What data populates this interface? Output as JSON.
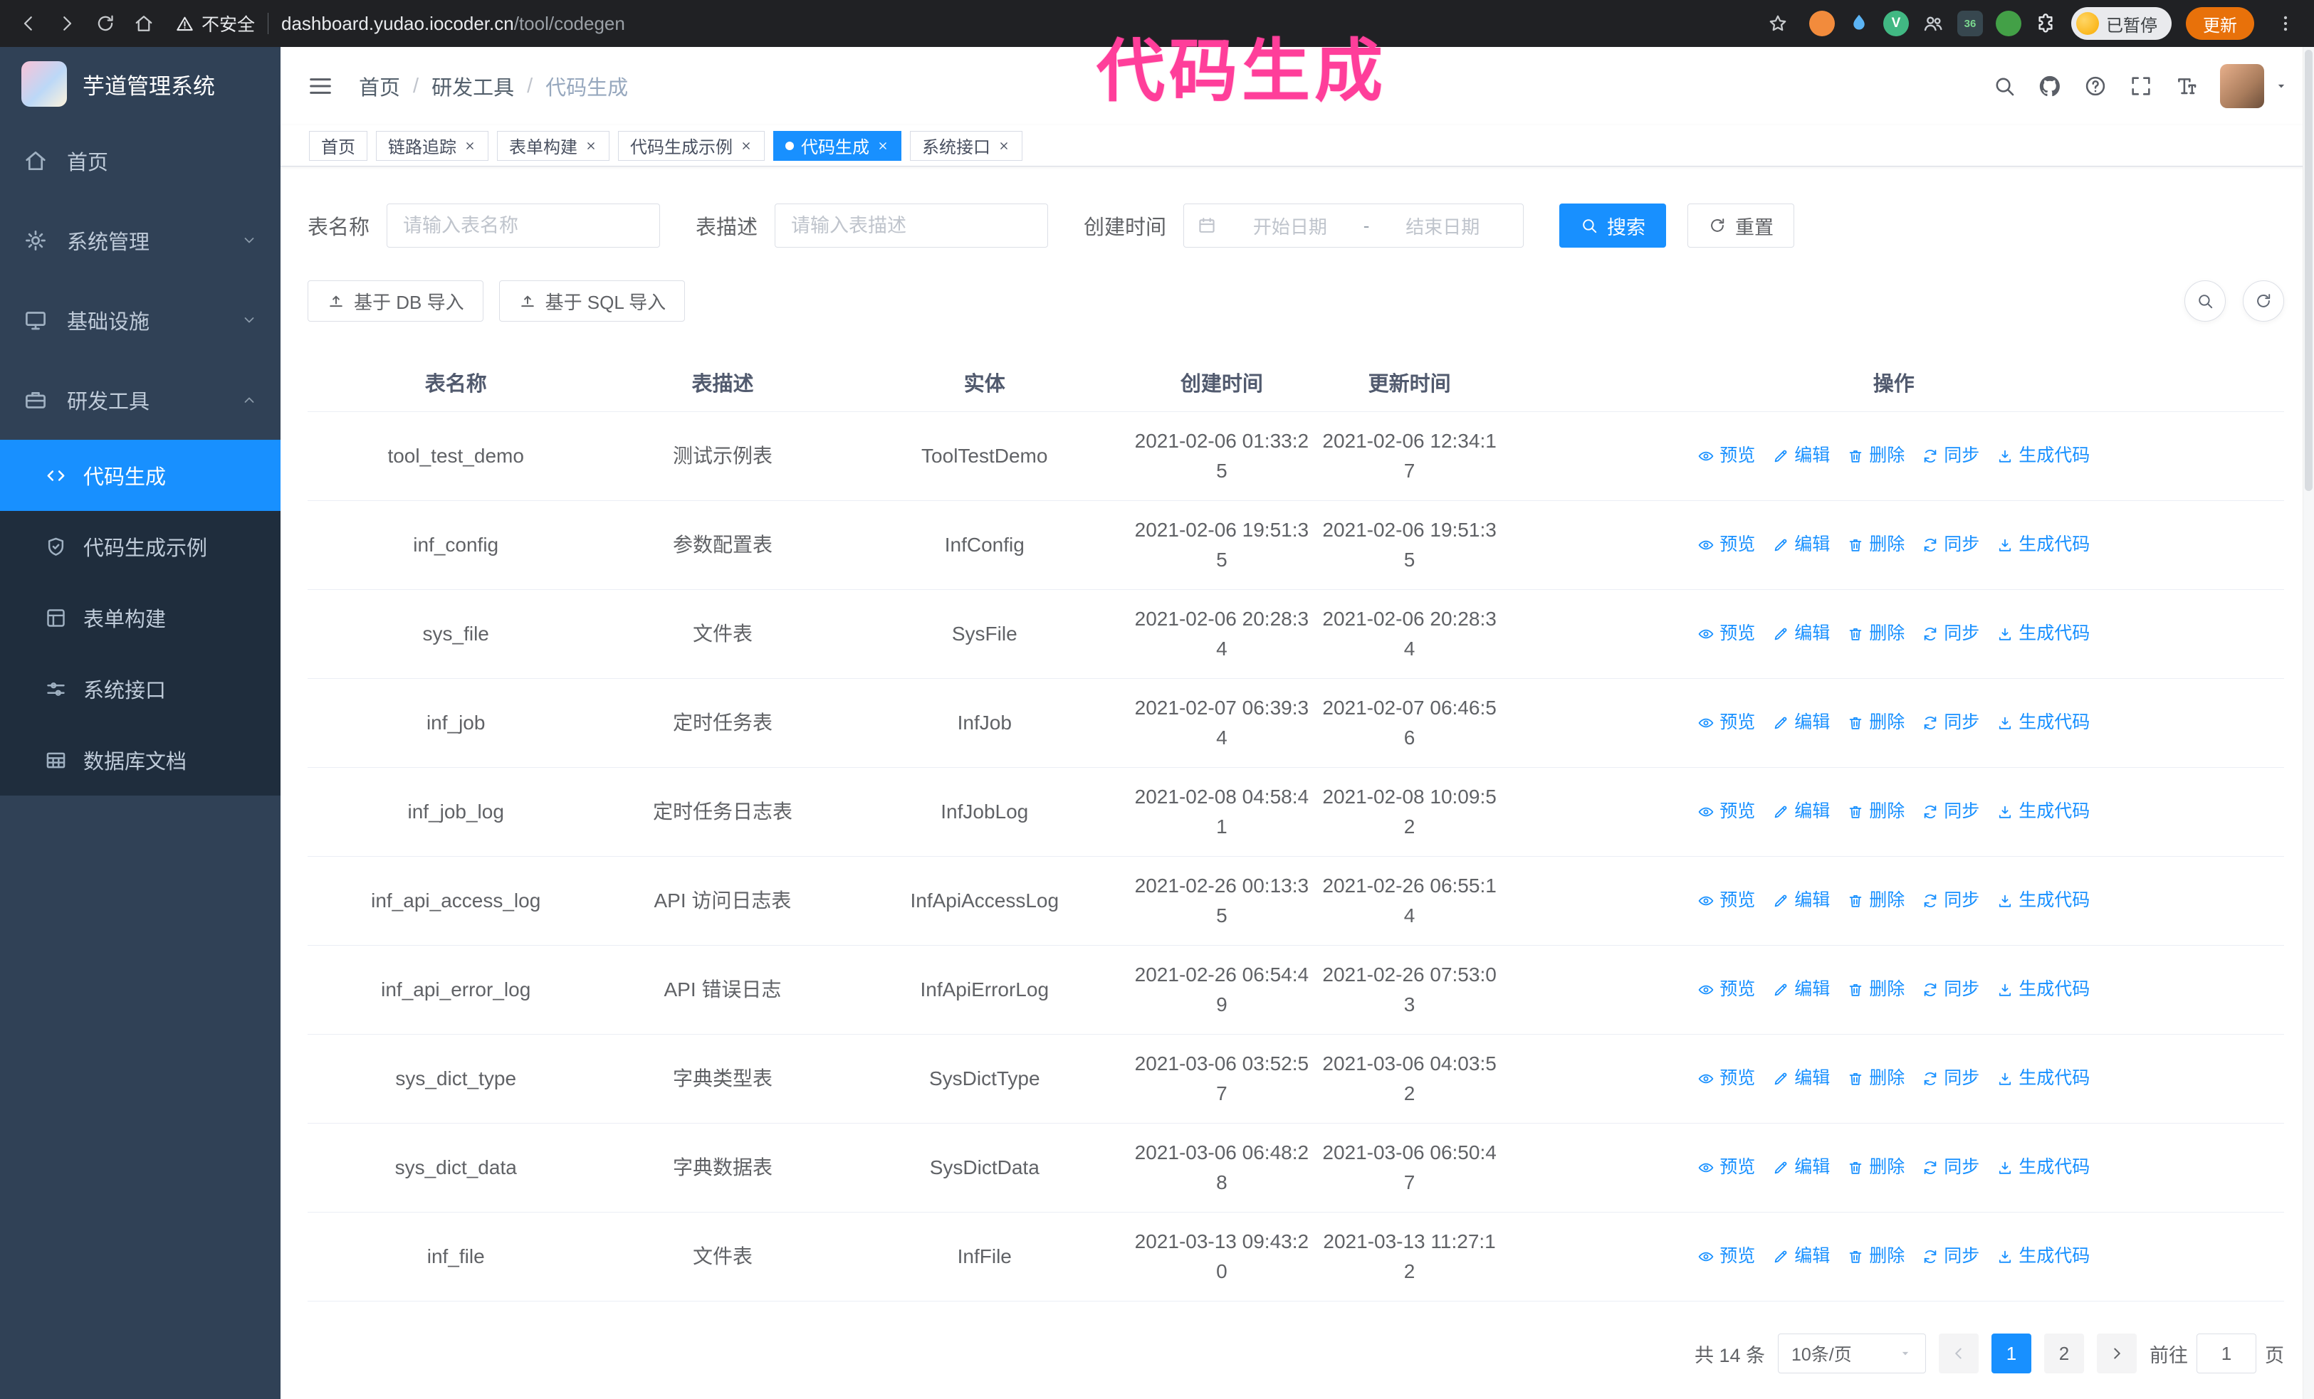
{
  "browser": {
    "security_label": "不安全",
    "url_host": "dashboard.yudao.iocoder.cn",
    "url_path": "/tool/codegen",
    "extensions": [
      {
        "id": "proxy",
        "shape": "circle",
        "color": "#f28b3c"
      },
      {
        "id": "drop",
        "shape": "icon",
        "icon": "drop",
        "color": "#5bb4f5"
      },
      {
        "id": "vue",
        "shape": "circle",
        "color": "#41b883",
        "label": "V"
      },
      {
        "id": "people",
        "shape": "icon",
        "icon": "people",
        "color": "#c9cdd2"
      },
      {
        "id": "badge",
        "shape": "square",
        "color": "#37474f",
        "label": "36",
        "label_color": "#7bd88f"
      },
      {
        "id": "leaf",
        "shape": "circle",
        "color": "#43a047"
      },
      {
        "id": "puzzle",
        "shape": "icon",
        "icon": "puzzle",
        "color": "#e8eaed"
      }
    ],
    "profile_badge": "已暂停",
    "update_label": "更新"
  },
  "annotation": {
    "text": "代码生成",
    "color": "#ff3e9a"
  },
  "sidebar": {
    "logo_title": "芋道管理系统",
    "menu": [
      {
        "id": "home",
        "label": "首页",
        "icon": "home",
        "type": "item"
      },
      {
        "id": "system",
        "label": "系统管理",
        "icon": "gear",
        "type": "group",
        "state": "collapsed"
      },
      {
        "id": "infra",
        "label": "基础设施",
        "icon": "monitor",
        "type": "group",
        "state": "collapsed"
      },
      {
        "id": "devtools",
        "label": "研发工具",
        "icon": "toolbox",
        "type": "group",
        "state": "expanded"
      }
    ],
    "submenu": [
      {
        "id": "codegen",
        "label": "代码生成",
        "icon": "code",
        "active": true
      },
      {
        "id": "codegen-example",
        "label": "代码生成示例",
        "icon": "shield",
        "active": false
      },
      {
        "id": "form-build",
        "label": "表单构建",
        "icon": "form",
        "active": false
      },
      {
        "id": "system-api",
        "label": "系统接口",
        "icon": "sliders",
        "active": false
      },
      {
        "id": "db-doc",
        "label": "数据库文档",
        "icon": "table-grid",
        "active": false
      }
    ]
  },
  "header": {
    "breadcrumb": [
      "首页",
      "研发工具",
      "代码生成"
    ]
  },
  "tags": [
    {
      "id": "home",
      "label": "首页",
      "closable": false,
      "active": false
    },
    {
      "id": "tracer",
      "label": "链路追踪",
      "closable": true,
      "active": false
    },
    {
      "id": "form-build",
      "label": "表单构建",
      "closable": true,
      "active": false
    },
    {
      "id": "codegen-example",
      "label": "代码生成示例",
      "closable": true,
      "active": false
    },
    {
      "id": "codegen",
      "label": "代码生成",
      "closable": true,
      "active": true
    },
    {
      "id": "system-api",
      "label": "系统接口",
      "closable": true,
      "active": false
    }
  ],
  "filters": {
    "name_label": "表名称",
    "name_placeholder": "请输入表名称",
    "desc_label": "表描述",
    "desc_placeholder": "请输入表描述",
    "time_label": "创建时间",
    "start_placeholder": "开始日期",
    "range_separator": "-",
    "end_placeholder": "结束日期",
    "search_label": "搜索",
    "reset_label": "重置"
  },
  "toolbar": {
    "db_import_label": "基于 DB 导入",
    "sql_import_label": "基于 SQL 导入"
  },
  "table": {
    "columns": [
      "表名称",
      "表描述",
      "实体",
      "创建时间",
      "更新时间",
      "操作"
    ],
    "actions": [
      {
        "key": "preview",
        "label": "预览",
        "icon": "eye"
      },
      {
        "key": "edit",
        "label": "编辑",
        "icon": "edit"
      },
      {
        "key": "delete",
        "label": "删除",
        "icon": "trash"
      },
      {
        "key": "sync",
        "label": "同步",
        "icon": "sync"
      },
      {
        "key": "generate",
        "label": "生成代码",
        "icon": "download"
      }
    ],
    "rows": [
      {
        "name": "tool_test_demo",
        "desc": "测试示例表",
        "entity": "ToolTestDemo",
        "created": "2021-02-06 01:33:25",
        "updated": "2021-02-06 12:34:17"
      },
      {
        "name": "inf_config",
        "desc": "参数配置表",
        "entity": "InfConfig",
        "created": "2021-02-06 19:51:35",
        "updated": "2021-02-06 19:51:35"
      },
      {
        "name": "sys_file",
        "desc": "文件表",
        "entity": "SysFile",
        "created": "2021-02-06 20:28:34",
        "updated": "2021-02-06 20:28:34"
      },
      {
        "name": "inf_job",
        "desc": "定时任务表",
        "entity": "InfJob",
        "created": "2021-02-07 06:39:34",
        "updated": "2021-02-07 06:46:56"
      },
      {
        "name": "inf_job_log",
        "desc": "定时任务日志表",
        "entity": "InfJobLog",
        "created": "2021-02-08 04:58:41",
        "updated": "2021-02-08 10:09:52"
      },
      {
        "name": "inf_api_access_log",
        "desc": "API 访问日志表",
        "entity": "InfApiAccessLog",
        "created": "2021-02-26 00:13:35",
        "updated": "2021-02-26 06:55:14"
      },
      {
        "name": "inf_api_error_log",
        "desc": "API 错误日志",
        "entity": "InfApiErrorLog",
        "created": "2021-02-26 06:54:49",
        "updated": "2021-02-26 07:53:03"
      },
      {
        "name": "sys_dict_type",
        "desc": "字典类型表",
        "entity": "SysDictType",
        "created": "2021-03-06 03:52:57",
        "updated": "2021-03-06 04:03:52"
      },
      {
        "name": "sys_dict_data",
        "desc": "字典数据表",
        "entity": "SysDictData",
        "created": "2021-03-06 06:48:28",
        "updated": "2021-03-06 06:50:47"
      },
      {
        "name": "inf_file",
        "desc": "文件表",
        "entity": "InfFile",
        "created": "2021-03-13 09:43:20",
        "updated": "2021-03-13 11:27:12"
      }
    ]
  },
  "pagination": {
    "total_label": "共 14 条",
    "page_size_label": "10条/页",
    "pages": [
      "1",
      "2"
    ],
    "current_page": "1",
    "goto_prefix": "前往",
    "goto_value": "1",
    "goto_suffix": "页"
  },
  "colors": {
    "primary": "#1890ff",
    "sidebar_bg": "#304156",
    "submenu_bg": "#1f2d3d"
  }
}
